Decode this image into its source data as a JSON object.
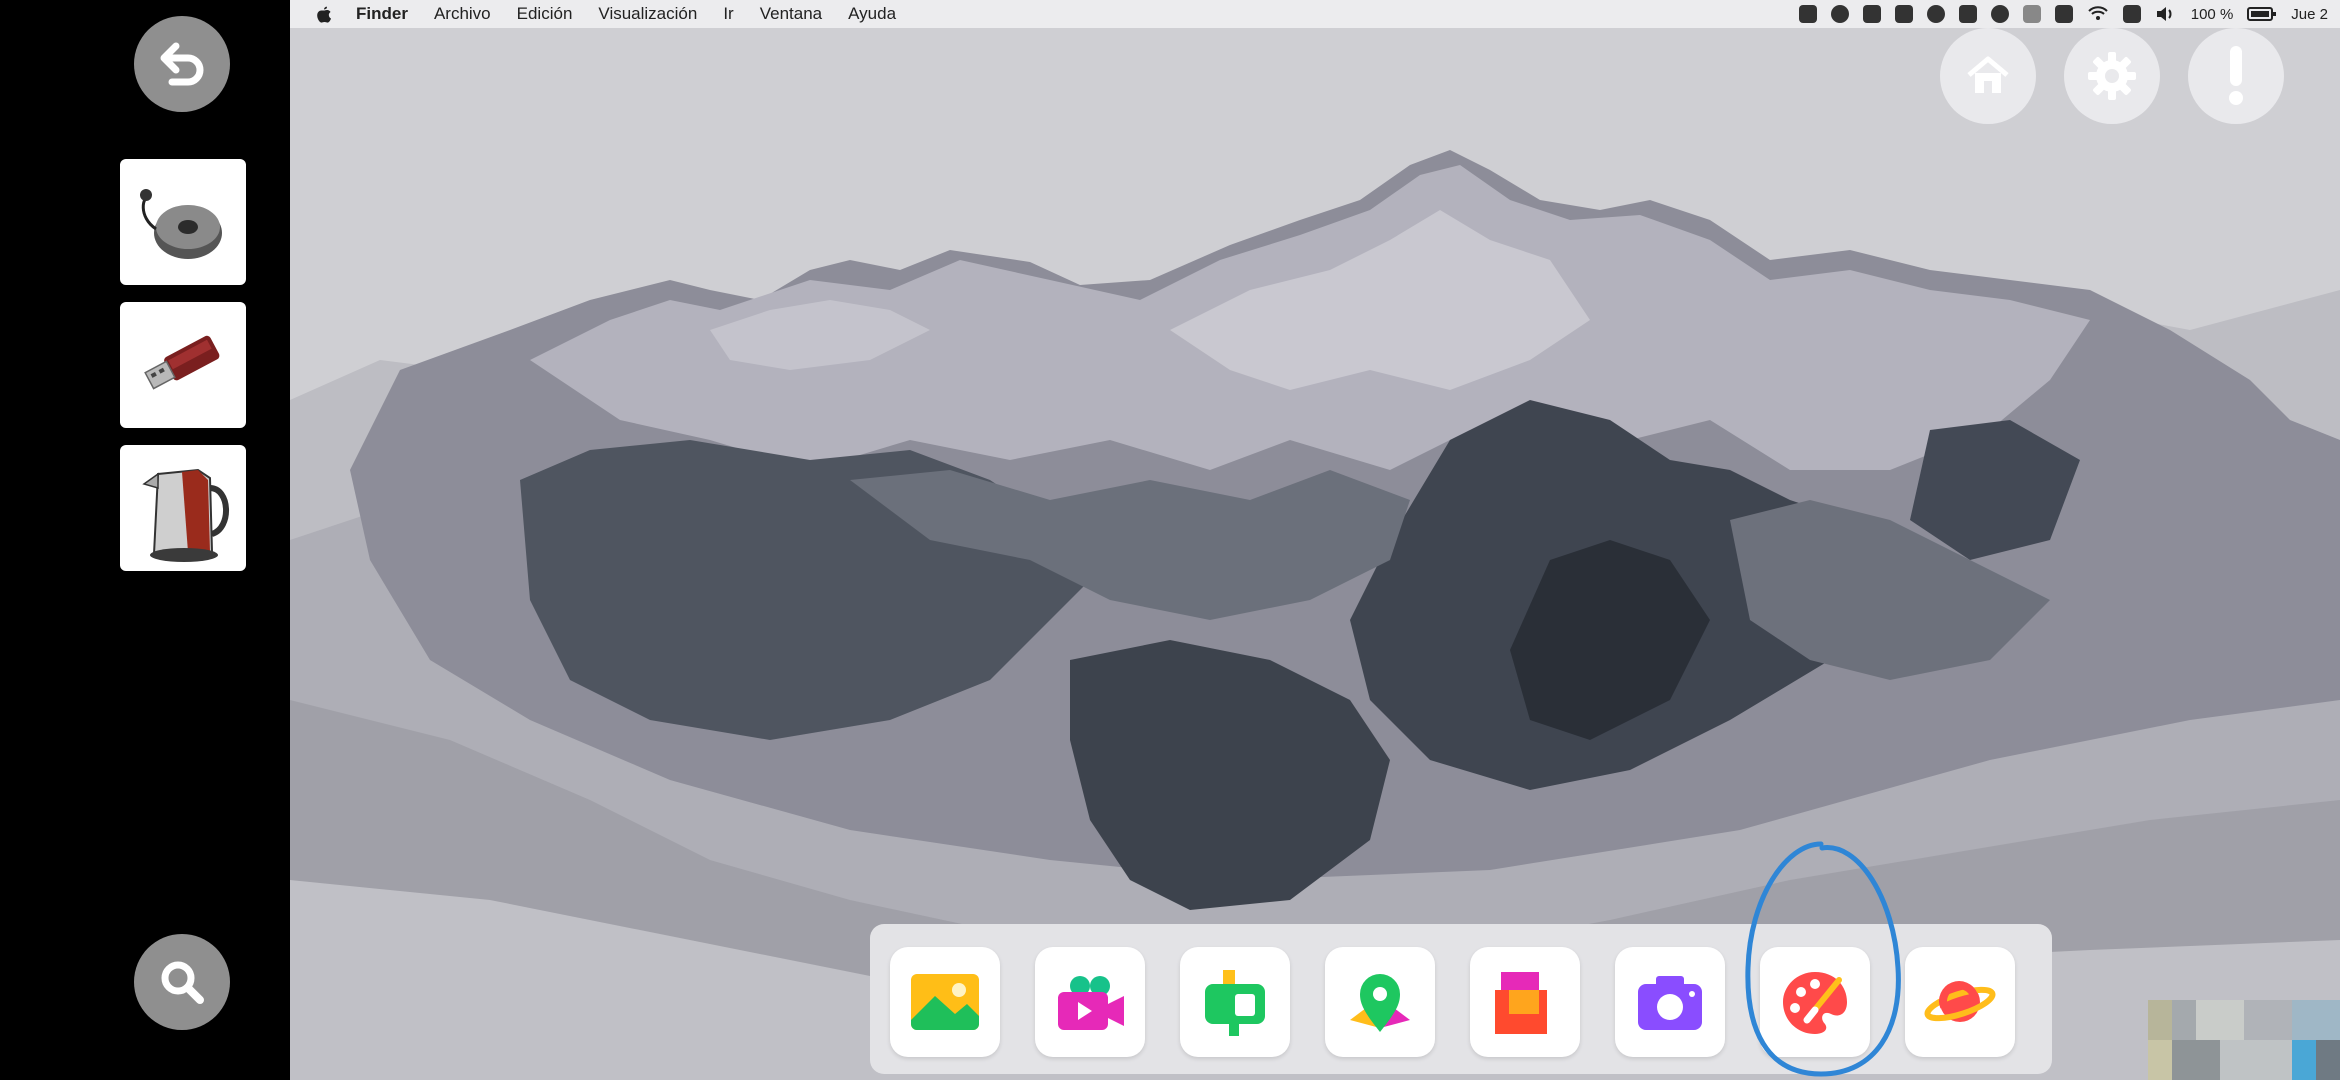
{
  "menubar": {
    "items": [
      "Finder",
      "Archivo",
      "Edición",
      "Visualización",
      "Ir",
      "Ventana",
      "Ayuda"
    ],
    "battery": "100 %",
    "clock": "Jue 2"
  },
  "sidebar": {
    "back_icon": "undo-arrow-icon",
    "search_icon": "search-icon",
    "thumbnails": [
      "wireless-charger-image",
      "usb-flash-drive-image",
      "electric-kettle-image"
    ]
  },
  "top_buttons": [
    "home-icon",
    "gear-icon",
    "exclamation-icon"
  ],
  "dock": {
    "apps": [
      "gallery-app",
      "video-app",
      "mailbox-app",
      "maps-app",
      "layers-app",
      "camera-app",
      "paint-app",
      "planet-app"
    ],
    "highlighted": "paint-app"
  },
  "colors": {
    "sidebar_bg": "#000000",
    "stage_bg": "#cfcfd3",
    "highlight_stroke": "#2f86d6"
  }
}
